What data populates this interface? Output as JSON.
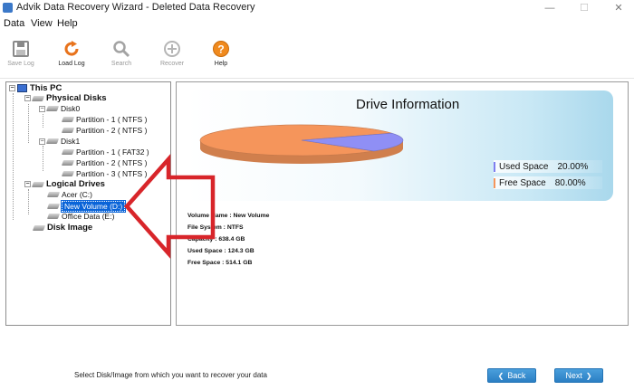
{
  "window": {
    "title": "Advik Data Recovery Wizard - Deleted Data Recovery",
    "minimize_glyph": "—",
    "maximize_glyph": "☐",
    "close_glyph": "✕"
  },
  "menu": {
    "items": [
      {
        "label": "Data"
      },
      {
        "label": "View"
      },
      {
        "label": "Help"
      }
    ]
  },
  "toolbar": {
    "save_log": {
      "label": "Save Log",
      "icon": "floppy-disk-icon",
      "enabled": false
    },
    "load_log": {
      "label": "Load Log",
      "icon": "refresh-icon",
      "enabled": true
    },
    "search": {
      "label": "Search",
      "icon": "search-icon",
      "enabled": false
    },
    "recover": {
      "label": "Recover",
      "icon": "plus-circle-icon",
      "enabled": false
    },
    "help": {
      "label": "Help",
      "icon": "help-icon",
      "enabled": true
    }
  },
  "tree": {
    "root": {
      "label": "This PC",
      "expander": "−"
    },
    "physical_disks": {
      "label": "Physical Disks",
      "expander": "−"
    },
    "disk0": {
      "label": "Disk0",
      "expander": "−"
    },
    "disk0_partitions": [
      {
        "label": "Partition - 1 ( NTFS )"
      },
      {
        "label": "Partition - 2 ( NTFS )"
      }
    ],
    "disk1": {
      "label": "Disk1",
      "expander": "−"
    },
    "disk1_partitions": [
      {
        "label": "Partition - 1 ( FAT32 )"
      },
      {
        "label": "Partition - 2 ( NTFS )"
      },
      {
        "label": "Partition - 3 ( NTFS )"
      }
    ],
    "logical_drives": {
      "label": "Logical Drives",
      "expander": "−"
    },
    "drives": [
      {
        "label": "Acer (C:)",
        "selected": false
      },
      {
        "label": "New Volume (D:)",
        "selected": true
      },
      {
        "label": "Office Data (E:)",
        "selected": false
      }
    ],
    "disk_image": {
      "label": "Disk Image"
    }
  },
  "drive_info": {
    "title": "Drive Information",
    "details": [
      {
        "text": "Volume Name : New Volume"
      },
      {
        "text": "File System : NTFS"
      },
      {
        "text": "Capacity : 638.4 GB"
      },
      {
        "text": "Used Space : 124.3 GB"
      },
      {
        "text": "Free Space : 514.1 GB"
      }
    ],
    "legend": {
      "used": {
        "label": "Used Space",
        "value": "20.00%"
      },
      "free": {
        "label": "Free Space",
        "value": "80.00%"
      }
    }
  },
  "chart_data": {
    "type": "pie",
    "title": "Drive Information",
    "categories": [
      "Used Space",
      "Free Space"
    ],
    "values": [
      20.0,
      80.0
    ],
    "colors": [
      "#8f8ff5",
      "#f5955b"
    ],
    "legend_position": "bottom-right"
  },
  "colors": {
    "accent_blue": "#2b7fc4",
    "selection": "#0a64d8",
    "annotation_arrow": "#d8252a",
    "used_space": "#8f8ff5",
    "free_space": "#f5955b"
  },
  "footer": {
    "hint": "Select Disk/Image from which you want to recover your data",
    "back_label": "Back",
    "back_icon": "chevron-left-icon",
    "next_label": "Next",
    "next_icon": "chevron-right-icon"
  }
}
